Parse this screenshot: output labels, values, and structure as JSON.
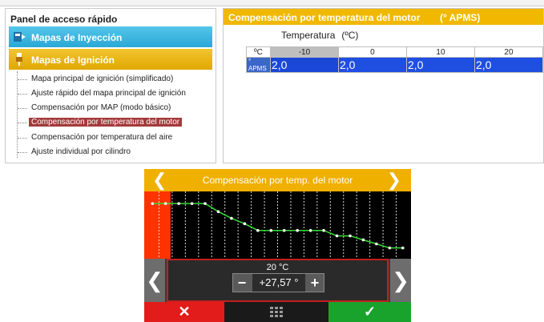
{
  "top_panel": {
    "quick_access": {
      "title": "Panel de acceso rápido",
      "categories": [
        {
          "label": "Mapas de Inyección",
          "color": "#2aa8d6"
        },
        {
          "label": "Mapas de Ignición",
          "color": "#e0a800"
        }
      ],
      "items": [
        {
          "label": "Mapa principal de ignición (simplificado)",
          "selected": false
        },
        {
          "label": "Ajuste rápido del mapa principal de ignición",
          "selected": false
        },
        {
          "label": "Compensación por MAP (modo básico)",
          "selected": false
        },
        {
          "label": "Compensación por temperatura del motor",
          "selected": true
        },
        {
          "label": "Compensación por temperatura del aire",
          "selected": false
        },
        {
          "label": "Ajuste individual por cilindro",
          "selected": false
        }
      ]
    },
    "table": {
      "title": "Compensación por temperatura del motor",
      "unit": "(° APMS)",
      "axis_label": "Temperatura",
      "axis_unit": "(ºC)",
      "corner_label": "ºC",
      "row_label": "° APMS",
      "columns": [
        "-10",
        "0",
        "10",
        "20"
      ],
      "values": [
        "2,0",
        "2,0",
        "2,0",
        "2,0"
      ]
    }
  },
  "device": {
    "title": "Compensación por temp. del motor",
    "temperature": "20 °C",
    "value": "+27,57 °",
    "minus": "−",
    "plus": "+",
    "cancel": "✕",
    "confirm": "✓",
    "colors": {
      "header": "#f0b000",
      "curve": "#33dd33",
      "highlight": "#ff3300",
      "cancel": "#e21b1b",
      "confirm": "#1aa32c"
    },
    "curve_data": {
      "type": "line",
      "points": 20,
      "selected_index": 0,
      "relative_levels": [
        0.18,
        0.18,
        0.18,
        0.18,
        0.18,
        0.3,
        0.4,
        0.48,
        0.58,
        0.58,
        0.58,
        0.58,
        0.58,
        0.58,
        0.66,
        0.66,
        0.72,
        0.78,
        0.84,
        0.84
      ]
    }
  }
}
